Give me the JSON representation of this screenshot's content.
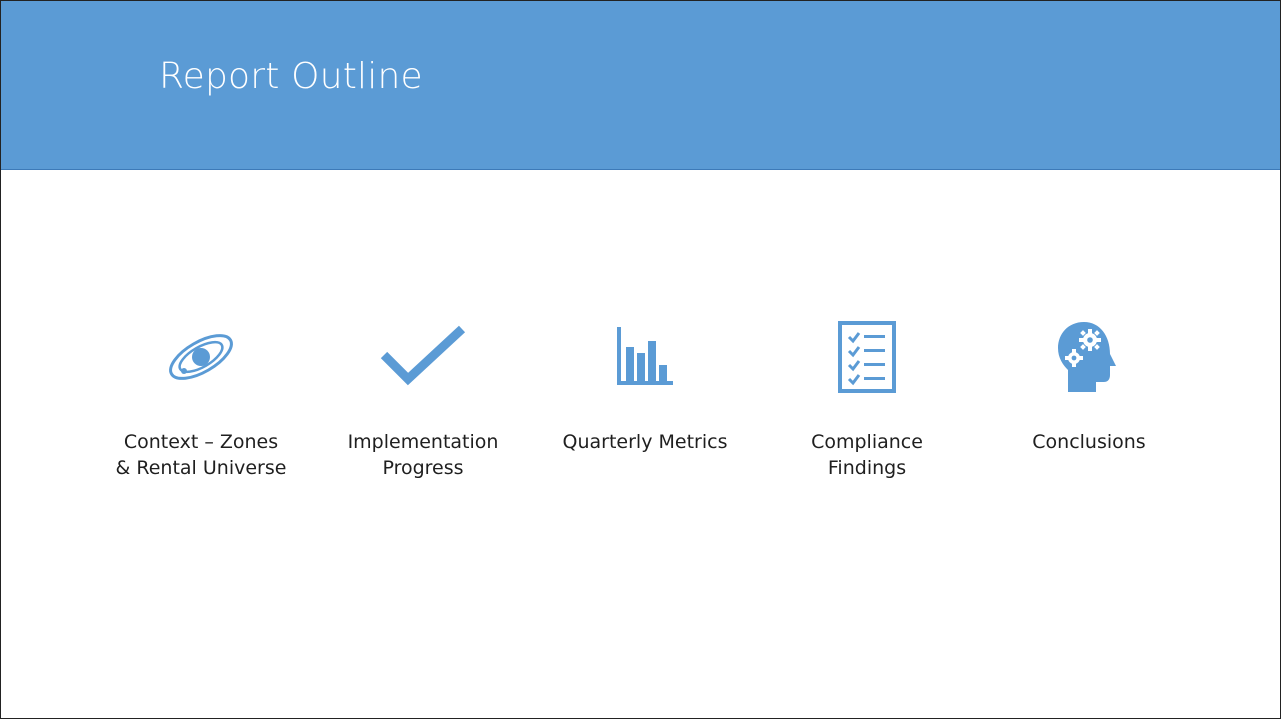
{
  "slide": {
    "title": "Report Outline",
    "accent_color": "#5b9bd5",
    "items": [
      {
        "icon": "orbit-icon",
        "label": "Context – Zones & Rental Universe"
      },
      {
        "icon": "checkmark-icon",
        "label": "Implementation Progress"
      },
      {
        "icon": "bar-chart-icon",
        "label": "Quarterly Metrics"
      },
      {
        "icon": "checklist-icon",
        "label": "Compliance Findings"
      },
      {
        "icon": "head-gears-icon",
        "label": "Conclusions"
      }
    ]
  }
}
